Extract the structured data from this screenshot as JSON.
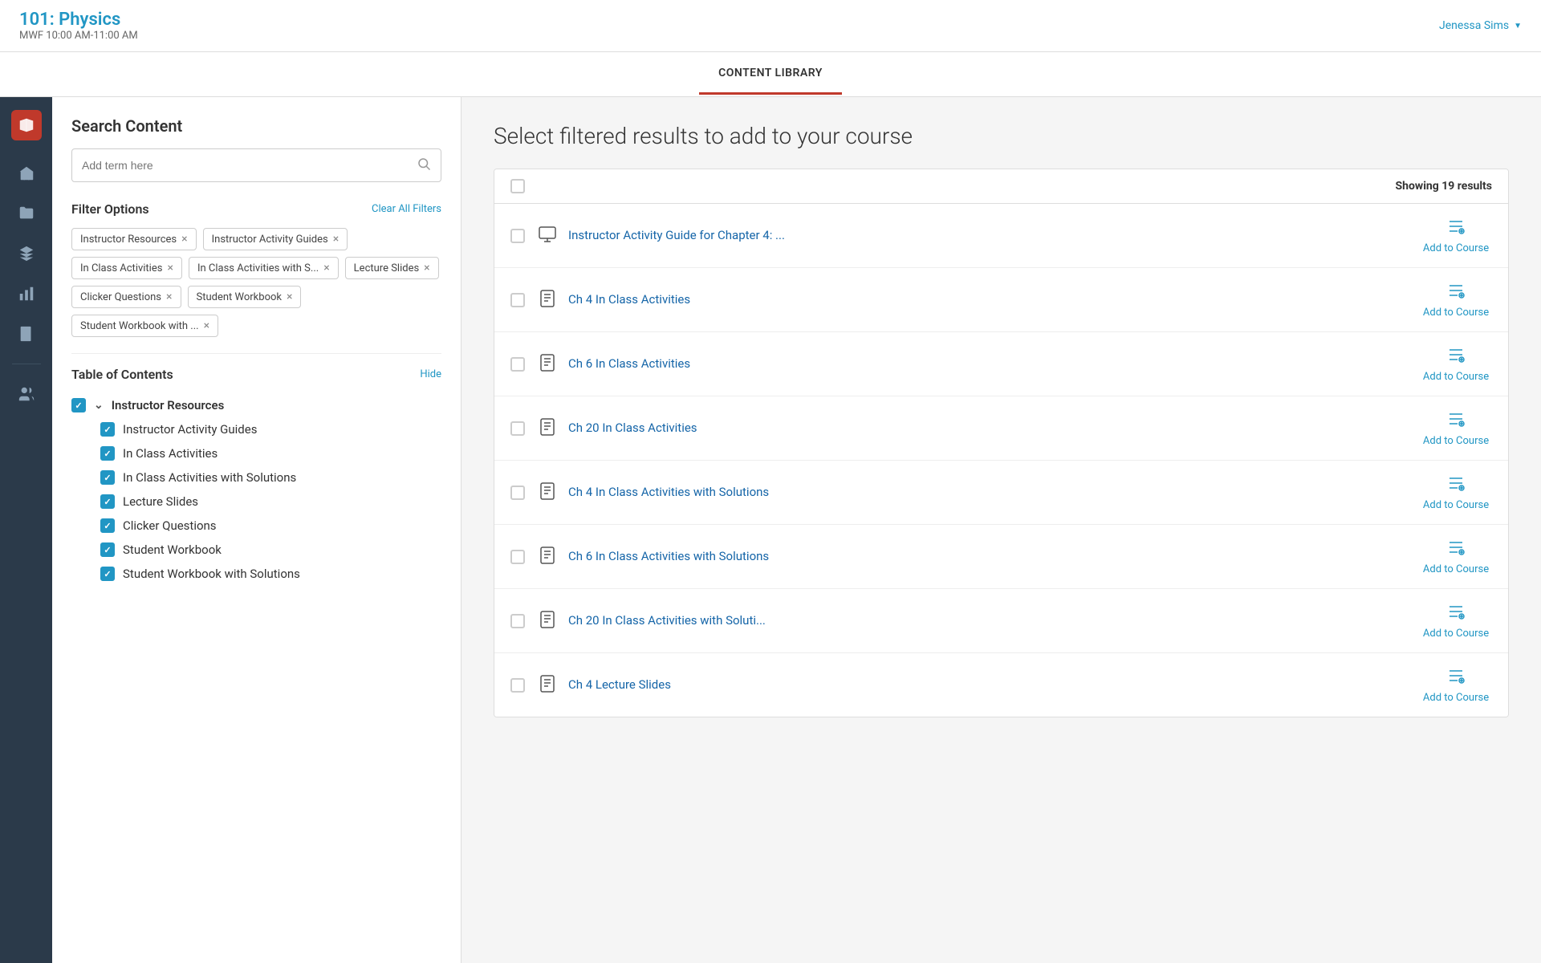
{
  "header": {
    "course_title": "101: Physics",
    "course_time": "MWF 10:00 AM-11:00 AM",
    "user_name": "Jenessa Sims"
  },
  "tabs": [
    {
      "id": "content-library",
      "label": "CONTENT LIBRARY",
      "active": true
    }
  ],
  "filter": {
    "heading": "Search Content",
    "search_placeholder": "Add term here",
    "clear_label": "Clear All Filters",
    "tags": [
      {
        "label": "Instructor Resources"
      },
      {
        "label": "Instructor Activity Guides"
      },
      {
        "label": "In Class Activities"
      },
      {
        "label": "In Class Activities with S..."
      },
      {
        "label": "Lecture Slides"
      },
      {
        "label": "Clicker Questions"
      },
      {
        "label": "Student Workbook"
      },
      {
        "label": "Student Workbook with ..."
      }
    ],
    "toc_heading": "Table of Contents",
    "toc_hide_label": "Hide",
    "toc_items": [
      {
        "id": "instructor-resources",
        "label": "Instructor Resources",
        "checked": true,
        "parent": true,
        "children": [
          {
            "id": "instructor-activity-guides",
            "label": "Instructor Activity Guides",
            "checked": true
          },
          {
            "id": "in-class-activities",
            "label": "In Class Activities",
            "checked": true
          },
          {
            "id": "in-class-activities-solutions",
            "label": "In Class Activities with Solutions",
            "checked": true
          },
          {
            "id": "lecture-slides",
            "label": "Lecture Slides",
            "checked": true
          },
          {
            "id": "clicker-questions",
            "label": "Clicker Questions",
            "checked": true
          },
          {
            "id": "student-workbook",
            "label": "Student Workbook",
            "checked": true
          },
          {
            "id": "student-workbook-solutions",
            "label": "Student Workbook with Solutions",
            "checked": true
          }
        ]
      }
    ]
  },
  "results": {
    "heading": "Select filtered results to add to your course",
    "count_label": "Showing 19 results",
    "add_label": "Add to Course",
    "items": [
      {
        "id": 1,
        "title": "Instructor Activity Guide for Chapter 4: ...",
        "type": "monitor"
      },
      {
        "id": 2,
        "title": "Ch 4 In Class Activities",
        "type": "document"
      },
      {
        "id": 3,
        "title": "Ch 6 In Class Activities",
        "type": "document"
      },
      {
        "id": 4,
        "title": "Ch 20 In Class Activities",
        "type": "document"
      },
      {
        "id": 5,
        "title": "Ch 4 In Class Activities with Solutions",
        "type": "document"
      },
      {
        "id": 6,
        "title": "Ch 6 In Class Activities with Solutions",
        "type": "document"
      },
      {
        "id": 7,
        "title": "Ch 20 In Class Activities with Soluti...",
        "type": "document"
      },
      {
        "id": 8,
        "title": "Ch 4 Lecture Slides",
        "type": "document"
      }
    ]
  },
  "nav": {
    "items": [
      {
        "id": "home",
        "icon": "home"
      },
      {
        "id": "folder",
        "icon": "folder"
      },
      {
        "id": "layers",
        "icon": "layers"
      },
      {
        "id": "chart",
        "icon": "chart"
      },
      {
        "id": "notebook",
        "icon": "notebook"
      },
      {
        "id": "users",
        "icon": "users"
      }
    ]
  }
}
